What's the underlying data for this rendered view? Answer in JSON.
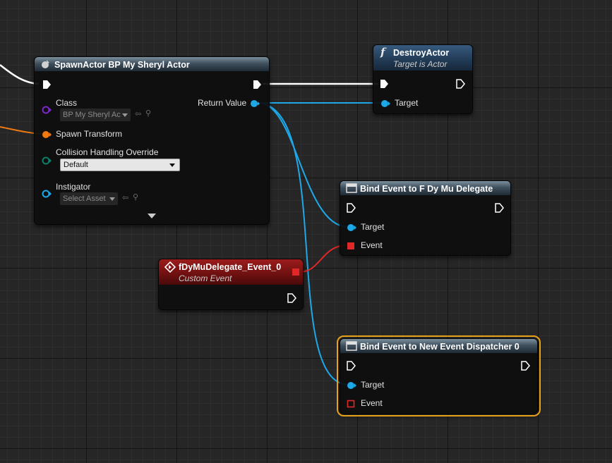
{
  "spawn_actor": {
    "title": "SpawnActor BP My Sheryl Actor",
    "class_label": "Class",
    "class_value": "BP My Sheryl Ac",
    "return_value_label": "Return Value",
    "spawn_transform_label": "Spawn Transform",
    "collision_label": "Collision Handling Override",
    "collision_value": "Default",
    "instigator_label": "Instigator",
    "instigator_value": "Select Asset"
  },
  "destroy_actor": {
    "title": "DestroyActor",
    "subtitle": "Target is Actor",
    "target_label": "Target"
  },
  "bind_event_1": {
    "title": "Bind Event to F Dy Mu Delegate",
    "target_label": "Target",
    "event_label": "Event"
  },
  "custom_event": {
    "title": "fDyMuDelegate_Event_0",
    "subtitle": "Custom Event"
  },
  "bind_event_2": {
    "title": "Bind Event to New Event Dispatcher 0",
    "target_label": "Target",
    "event_label": "Event"
  },
  "colors": {
    "exec_wire": "#ffffff",
    "object_pin": "#1ea8e8",
    "transform_pin": "#f07a12",
    "class_pin": "#7a28c8",
    "enum_pin": "#0d7f6a",
    "delegate_pin": "#e02828",
    "selected_outline": "#e8a21a"
  },
  "icons": {
    "spawn": "spawn-actor-icon",
    "function": "function-icon",
    "bind_event": "bind-event-icon",
    "custom_event": "custom-event-icon"
  }
}
